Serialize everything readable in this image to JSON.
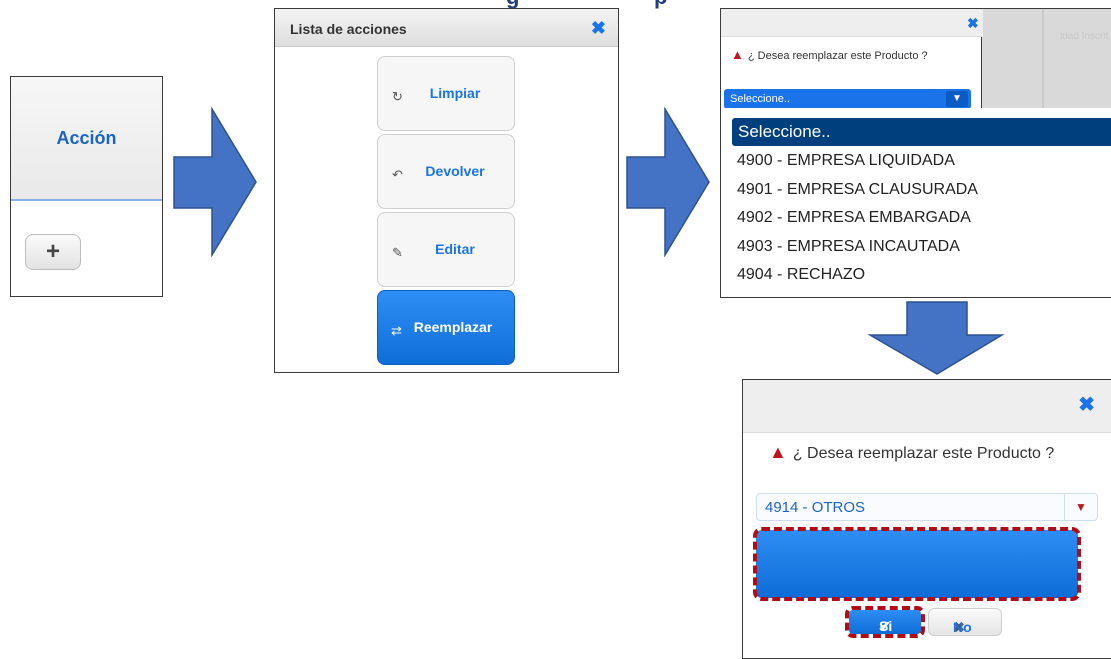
{
  "heading": {
    "left_fragment": "g",
    "right_fragment": "p"
  },
  "panel1": {
    "header": "Acción",
    "add_button": "+"
  },
  "panel2": {
    "title": "Lista de acciones",
    "close": "✖",
    "actions": [
      {
        "label": "Limpiar",
        "icon": "↻"
      },
      {
        "label": "Devolver",
        "icon": "↶"
      },
      {
        "label": "Editar",
        "icon": "✎"
      },
      {
        "label": "Reemplazar",
        "icon": "⇄"
      }
    ]
  },
  "panel3": {
    "close": "✖",
    "question": "¿ Desea reemplazar este Producto ?",
    "select_value": "Seleccione..",
    "background_text": "idad Inscrit",
    "options": [
      "Seleccione..",
      "4900 - EMPRESA LIQUIDADA",
      "4901 - EMPRESA CLAUSURADA",
      "4902 - EMPRESA EMBARGADA",
      "4903 - EMPRESA INCAUTADA",
      "4904 - RECHAZO"
    ]
  },
  "panel4": {
    "close": "✖",
    "question": "¿ Desea reemplazar este Producto ?",
    "select_value": "4914 - OTROS",
    "yes_label": "Si",
    "no_label": "No"
  },
  "colors": {
    "accent": "#1a73e8",
    "arrow": "#4472c4",
    "highlight_border": "#b00d16",
    "selected_option": "#003f7d"
  }
}
